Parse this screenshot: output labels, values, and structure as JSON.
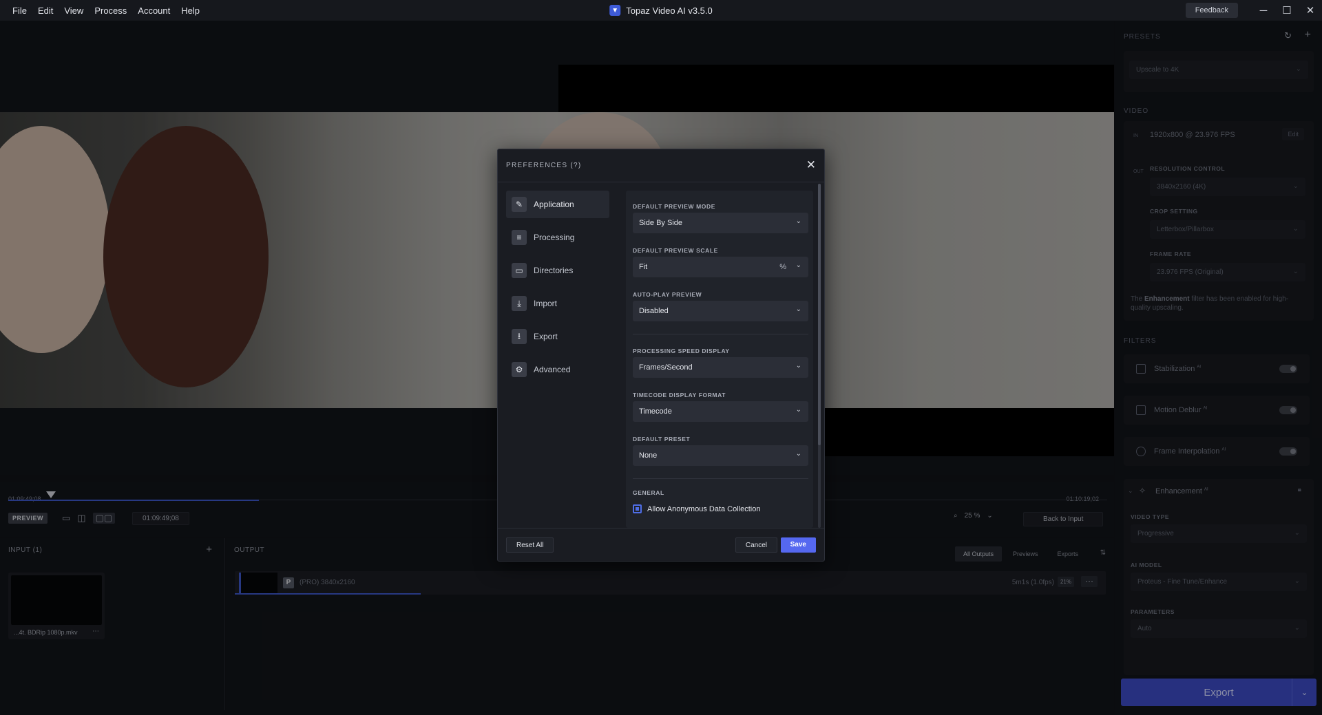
{
  "titlebar": {
    "menu": [
      "File",
      "Edit",
      "View",
      "Process",
      "Account",
      "Help"
    ],
    "app_title": "Topaz Video AI  v3.5.0",
    "feedback": "Feedback"
  },
  "timeline": {
    "start_time": "01:09:49;08",
    "end_time": "01:10:19;02",
    "preview_badge": "PREVIEW",
    "current_time": "01:09:49;08",
    "zoom": "25 %",
    "back_to_input": "Back to Input"
  },
  "input_panel": {
    "header": "INPUT (1)",
    "file_name": "...4t. BDRip 1080p.mkv"
  },
  "output_panel": {
    "header": "OUTPUT",
    "tabs": [
      "All Outputs",
      "Previews",
      "Exports"
    ],
    "row": {
      "badge": "P",
      "label": "(PRO) 3840x2160",
      "time": "5m1s (1.0fps)",
      "percent": "21%"
    }
  },
  "sidebar": {
    "presets_header": "PRESETS",
    "preset_value": "Upscale to 4K",
    "video_header": "VIDEO",
    "in_tag": "IN",
    "in_spec": "1920x800 @ 23.976 FPS",
    "edit": "Edit",
    "out_tag": "OUT",
    "resolution_label": "RESOLUTION CONTROL",
    "resolution_value": "3840x2160 (4K)",
    "crop_label": "CROP SETTING",
    "crop_value": "Letterbox/Pillarbox",
    "framerate_label": "FRAME RATE",
    "framerate_value": "23.976 FPS (Original)",
    "note_prefix": "The ",
    "note_bold": "Enhancement",
    "note_suffix": " filter has been enabled for high-quality upscaling.",
    "filters_header": "FILTERS",
    "filters": [
      "Stabilization",
      "Motion Deblur",
      "Frame Interpolation"
    ],
    "enhancement": "Enhancement",
    "ai_sup": "AI",
    "video_type_label": "VIDEO TYPE",
    "video_type_value": "Progressive",
    "ai_model_label": "AI MODEL",
    "ai_model_value": "Proteus - Fine Tune/Enhance",
    "parameters_label": "PARAMETERS",
    "parameters_value": "Auto",
    "export_label": "Export"
  },
  "dialog": {
    "title": "PREFERENCES  (?)",
    "nav": [
      "Application",
      "Processing",
      "Directories",
      "Import",
      "Export",
      "Advanced"
    ],
    "fields": {
      "preview_mode_label": "DEFAULT PREVIEW MODE",
      "preview_mode_value": "Side By Side",
      "preview_scale_label": "DEFAULT PREVIEW SCALE",
      "preview_scale_value": "Fit",
      "preview_scale_unit": "%",
      "autoplay_label": "AUTO-PLAY PREVIEW",
      "autoplay_value": "Disabled",
      "speed_label": "PROCESSING SPEED DISPLAY",
      "speed_value": "Frames/Second",
      "timecode_label": "TIMECODE DISPLAY FORMAT",
      "timecode_value": "Timecode",
      "preset_label": "DEFAULT PRESET",
      "preset_value": "None",
      "general_label": "GENERAL",
      "anon_label": "Allow Anonymous Data Collection"
    },
    "reset_all": "Reset All",
    "cancel": "Cancel",
    "save": "Save"
  }
}
